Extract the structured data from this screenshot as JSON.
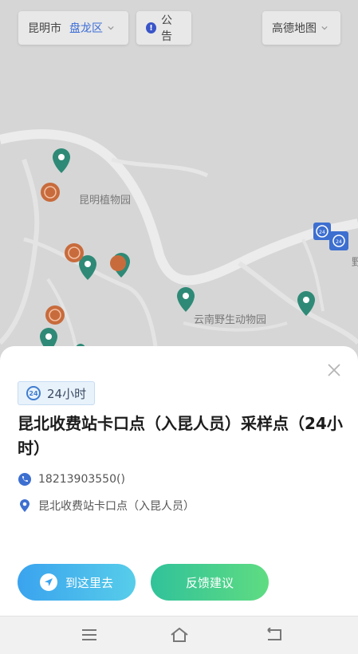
{
  "topbar": {
    "city": "昆明市",
    "district": "盘龙区",
    "notice_label": "公告",
    "notice_icon": "!",
    "map_source": "高德地图"
  },
  "map": {
    "labels": {
      "botanical_garden": "昆明植物园",
      "zoo": "云南野生动物园",
      "edge_char": "野"
    },
    "badge_24": "24",
    "colors": {
      "teal_pin": "#2e8a76",
      "orange_pin": "#c86b3c",
      "blue_marker": "#3d6fd0"
    }
  },
  "sheet": {
    "badge_icon_text": "24",
    "badge_label": "24小时",
    "title": "昆北收费站卡口点（入昆人员）采样点（24小时）",
    "phone": "18213903550()",
    "address": "昆北收费站卡口点（入昆人员）",
    "buttons": {
      "navigate": "到这里去",
      "feedback": "反馈建议"
    },
    "colors": {
      "navigate": "#3aa3ee",
      "feedback": "#3bc996"
    }
  },
  "navbar": {
    "icons": [
      "menu-icon",
      "home-icon",
      "back-icon"
    ]
  }
}
